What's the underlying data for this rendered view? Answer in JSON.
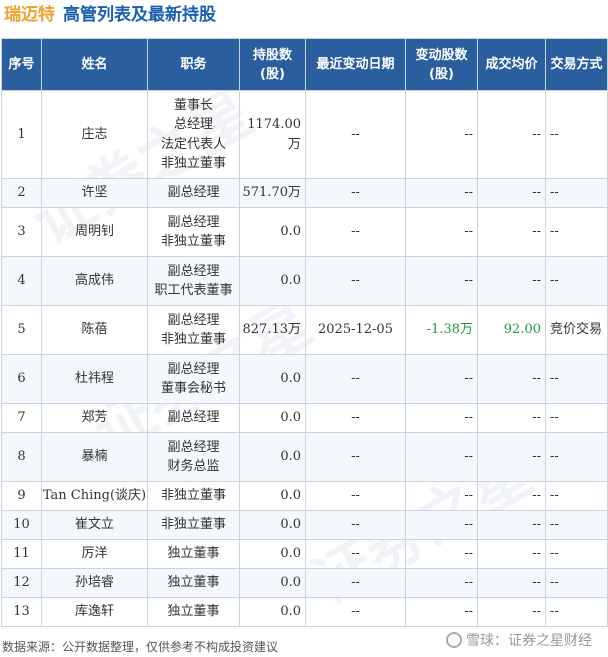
{
  "title": {
    "company": "瑞迈特",
    "subtitle": "高管列表及最新持股"
  },
  "table": {
    "headers": [
      "序号",
      "姓名",
      "职务",
      "持股数\n(股)",
      "最近变动日期",
      "变动股数\n(股)",
      "成交均价",
      "交易方式"
    ],
    "rows": [
      {
        "no": "1",
        "name": "庄志",
        "roles": [
          "董事长",
          "总经理",
          "法定代表人",
          "非独立董事"
        ],
        "shares": "1174.00万",
        "date": "--",
        "change": "--",
        "price": "--",
        "method": "--"
      },
      {
        "no": "2",
        "name": "许坚",
        "roles": [
          "副总经理"
        ],
        "shares": "571.70万",
        "date": "--",
        "change": "--",
        "price": "--",
        "method": "--"
      },
      {
        "no": "3",
        "name": "周明钊",
        "roles": [
          "副总经理",
          "非独立董事"
        ],
        "shares": "0.0",
        "date": "--",
        "change": "--",
        "price": "--",
        "method": "--"
      },
      {
        "no": "4",
        "name": "高成伟",
        "roles": [
          "副总经理",
          "职工代表董事"
        ],
        "shares": "0.0",
        "date": "--",
        "change": "--",
        "price": "--",
        "method": "--"
      },
      {
        "no": "5",
        "name": "陈蓓",
        "roles": [
          "副总经理",
          "非独立董事"
        ],
        "shares": "827.13万",
        "date": "2025-12-05",
        "change": "-1.38万",
        "price": "92.00",
        "method": "竞价交易"
      },
      {
        "no": "6",
        "name": "杜祎程",
        "roles": [
          "副总经理",
          "董事会秘书"
        ],
        "shares": "0.0",
        "date": "--",
        "change": "--",
        "price": "--",
        "method": "--"
      },
      {
        "no": "7",
        "name": "郑芳",
        "roles": [
          "副总经理"
        ],
        "shares": "0.0",
        "date": "--",
        "change": "--",
        "price": "--",
        "method": "--"
      },
      {
        "no": "8",
        "name": "暴楠",
        "roles": [
          "副总经理",
          "财务总监"
        ],
        "shares": "0.0",
        "date": "--",
        "change": "--",
        "price": "--",
        "method": "--"
      },
      {
        "no": "9",
        "name": "Tan Ching(谈庆)",
        "roles": [
          "非独立董事"
        ],
        "shares": "0.0",
        "date": "--",
        "change": "--",
        "price": "--",
        "method": "--"
      },
      {
        "no": "10",
        "name": "崔文立",
        "roles": [
          "非独立董事"
        ],
        "shares": "0.0",
        "date": "--",
        "change": "--",
        "price": "--",
        "method": "--"
      },
      {
        "no": "11",
        "name": "厉洋",
        "roles": [
          "独立董事"
        ],
        "shares": "0.0",
        "date": "--",
        "change": "--",
        "price": "--",
        "method": "--"
      },
      {
        "no": "12",
        "name": "孙培睿",
        "roles": [
          "独立董事"
        ],
        "shares": "0.0",
        "date": "--",
        "change": "--",
        "price": "--",
        "method": "--"
      },
      {
        "no": "13",
        "name": "库逸轩",
        "roles": [
          "独立董事"
        ],
        "shares": "0.0",
        "date": "--",
        "change": "--",
        "price": "--",
        "method": "--"
      }
    ]
  },
  "footer": {
    "source": "数据来源：公开数据整理，仅供参考不构成投资建议",
    "brand": "雪球：证券之星财经"
  },
  "colors": {
    "header_bg": "#2a5e9e",
    "company": "#f0a030",
    "subtitle": "#1a5fb0",
    "change_negative": "#1e9a3c"
  },
  "icons": {
    "brand_logo": "xueqiu-logo-icon"
  }
}
